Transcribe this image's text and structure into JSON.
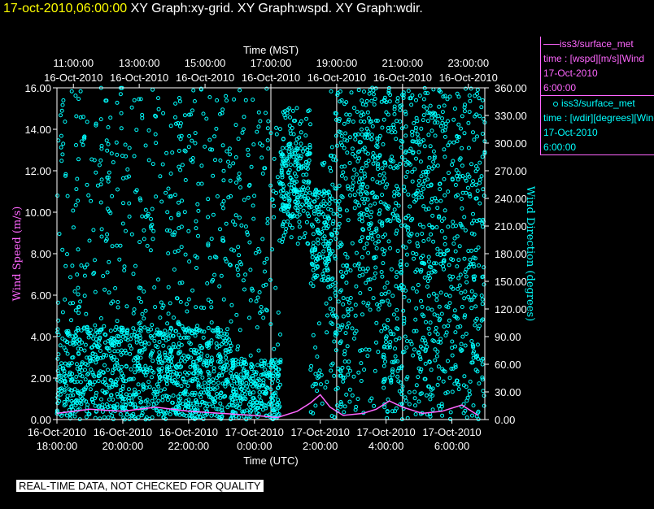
{
  "header": {
    "timestamp": "17-oct-2010,06:00:00",
    "title": "XY Graph:xy-grid.  XY Graph:wspd.  XY Graph:wdir."
  },
  "colors": {
    "background": "#000000",
    "wspd": "#ff66ff",
    "wdir": "#00ffff",
    "timestamp": "#ffff00",
    "grid": "#ffffff"
  },
  "note": "REAL-TIME DATA, NOT CHECKED FOR QUALITY",
  "legend": [
    {
      "line1": "iss3/surface_met",
      "line2": "time : [wspd][m/s][Wind",
      "line3": "17-Oct-2010",
      "line4": "6:00:00"
    },
    {
      "line1": "iss3/surface_met",
      "line2": "time : [wdir][degrees][Wind",
      "line3": "17-Oct-2010",
      "line4": "6:00:00"
    }
  ],
  "chart_data": {
    "type": "scatter",
    "top_axis_title": "Time (MST)",
    "bottom_axis_title": "Time (UTC)",
    "left_axis_title": "Wind Speed (m/s)",
    "right_axis_title": "Wind Direction (degrees)",
    "x_hours_range": [
      17.5,
      30.5
    ],
    "top_ticks": [
      {
        "hour": 18,
        "time": "11:00:00",
        "date": "16-Oct-2010"
      },
      {
        "hour": 20,
        "time": "13:00:00",
        "date": "16-Oct-2010"
      },
      {
        "hour": 22,
        "time": "15:00:00",
        "date": "16-Oct-2010"
      },
      {
        "hour": 24,
        "time": "17:00:00",
        "date": "16-Oct-2010"
      },
      {
        "hour": 26,
        "time": "19:00:00",
        "date": "16-Oct-2010"
      },
      {
        "hour": 28,
        "time": "21:00:00",
        "date": "16-Oct-2010"
      },
      {
        "hour": 30,
        "time": "23:00:00",
        "date": "16-Oct-2010"
      }
    ],
    "bottom_ticks": [
      {
        "hour": 17.5,
        "date": "16-Oct-2010",
        "time": "18:00:00"
      },
      {
        "hour": 19.5,
        "date": "16-Oct-2010",
        "time": "20:00:00"
      },
      {
        "hour": 21.5,
        "date": "16-Oct-2010",
        "time": "22:00:00"
      },
      {
        "hour": 23.5,
        "date": "17-Oct-2010",
        "time": "0:00:00"
      },
      {
        "hour": 25.5,
        "date": "17-Oct-2010",
        "time": "2:00:00"
      },
      {
        "hour": 27.5,
        "date": "17-Oct-2010",
        "time": "4:00:00"
      },
      {
        "hour": 29.5,
        "date": "17-Oct-2010",
        "time": "6:00:00"
      }
    ],
    "left_ylim": [
      0,
      16
    ],
    "left_ticks": [
      "0.00",
      "2.00",
      "4.00",
      "6.00",
      "8.00",
      "10.00",
      "12.00",
      "14.00",
      "16.00"
    ],
    "right_ylim": [
      0,
      360
    ],
    "right_ticks": [
      "0.00",
      "30.00",
      "60.00",
      "90.00",
      "120.00",
      "150.00",
      "180.00",
      "210.00",
      "240.00",
      "270.00",
      "300.00",
      "330.00",
      "360.00"
    ],
    "vertical_grid_hours": [
      24,
      26,
      28
    ],
    "series": [
      {
        "name": "iss3/surface_met time : [wspd][m/s]",
        "axis": "left",
        "style": "line",
        "segments_hours": [
          [
            17.5,
            0.3
          ],
          [
            18.5,
            0.5
          ],
          [
            19.5,
            0.4
          ],
          [
            20.5,
            0.6
          ],
          [
            21.5,
            0.4
          ],
          [
            22.5,
            0.3
          ],
          [
            23.5,
            0.2
          ],
          [
            24.2,
            0.1
          ],
          [
            24.8,
            0.4
          ],
          [
            25.2,
            0.8
          ],
          [
            25.5,
            1.2
          ],
          [
            25.8,
            0.6
          ],
          [
            26.2,
            0.2
          ],
          [
            26.8,
            0.3
          ],
          [
            27.2,
            0.5
          ],
          [
            27.6,
            0.9
          ],
          [
            28.0,
            0.6
          ],
          [
            28.6,
            0.3
          ],
          [
            29.2,
            0.4
          ],
          [
            29.8,
            0.7
          ],
          [
            30.3,
            0.2
          ]
        ]
      },
      {
        "name": "iss3/surface_met time : [wdir][degrees]",
        "axis": "right",
        "style": "dots",
        "bands": [
          {
            "from_hour": 17.5,
            "to_hour": 22.8,
            "low": 0,
            "high": 360,
            "dense_low": 0,
            "dense_high": 100
          },
          {
            "from_hour": 22.8,
            "to_hour": 24.3,
            "low": 0,
            "high": 360,
            "dense_low": 0,
            "dense_high": 65
          },
          {
            "from_hour": 24.3,
            "to_hour": 25.2,
            "low": 190,
            "high": 340,
            "dense_low": 220,
            "dense_high": 300
          },
          {
            "from_hour": 25.2,
            "to_hour": 25.8,
            "low": 0,
            "high": 280,
            "dense_low": 150,
            "dense_high": 250
          },
          {
            "from_hour": 25.8,
            "to_hour": 26.6,
            "low": 0,
            "high": 360,
            "dense_low": 0,
            "dense_high": 360
          },
          {
            "from_hour": 26.6,
            "to_hour": 27.4,
            "low": 0,
            "high": 360,
            "dense_low": 150,
            "dense_high": 360
          },
          {
            "from_hour": 27.4,
            "to_hour": 30.5,
            "low": 0,
            "high": 360,
            "dense_low": 0,
            "dense_high": 360
          }
        ]
      }
    ]
  }
}
